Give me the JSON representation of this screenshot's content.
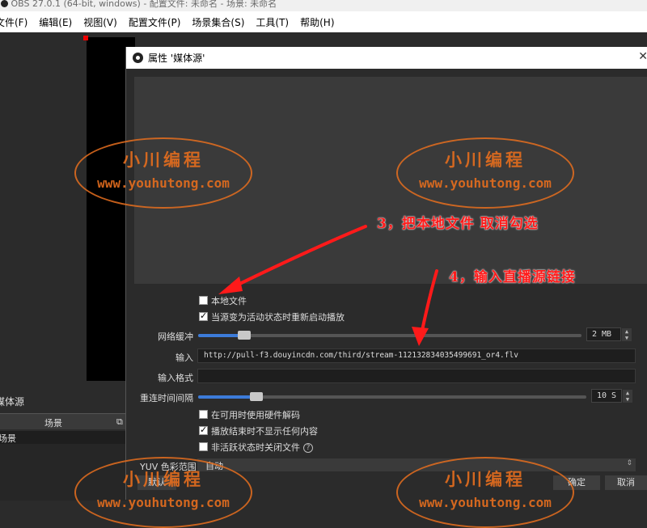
{
  "window": {
    "title": "OBS 27.0.1 (64-bit, windows) - 配置文件: 未命名 - 场景: 未命名"
  },
  "menu": [
    "文件(F)",
    "编辑(E)",
    "视图(V)",
    "配置文件(P)",
    "场景集合(S)",
    "工具(T)",
    "帮助(H)"
  ],
  "dock": {
    "title": "媒体源",
    "header": "场景",
    "item": "场景"
  },
  "dialog": {
    "title": "属性 '媒体源'",
    "local_file": "本地文件",
    "restart_on_active": "当源变为活动状态时重新启动播放",
    "network_buffer_label": "网络缓冲",
    "network_buffer_value": "2 MB",
    "network_buffer_fraction": 0.12,
    "input_label": "输入",
    "input_value": "http://pull-f3.douyincdn.com/third/stream-112132834035499691_or4.flv",
    "input_format_label": "输入格式",
    "input_format_value": "",
    "reconnect_label": "重连时间间隔",
    "reconnect_value": "10 S",
    "reconnect_fraction": 0.15,
    "hw_decode": "在可用时使用硬件解码",
    "hide_on_end": "播放结束时不显示任何内容",
    "close_inactive": "非活跃状态时关闭文件",
    "help_glyph": "?",
    "yuv_label": "YUV 色彩范围",
    "yuv_value": "自动",
    "defaults_button": "默认",
    "ok_button": "确定",
    "cancel_button": "取消",
    "local_file_checked": false,
    "restart_checked": true,
    "hw_decode_checked": false,
    "hide_on_end_checked": true,
    "close_inactive_checked": false
  },
  "annotations": {
    "step3": "3，把本地文件  取消勾选",
    "step4": "4，输入直播源链接"
  },
  "watermark": {
    "line1": "小川编程",
    "line2": "www.youhutong.com"
  },
  "colors": {
    "arrow": "#ff1a1a",
    "watermark": "#e66e1e",
    "slider_fill": "#3c7bd9"
  }
}
